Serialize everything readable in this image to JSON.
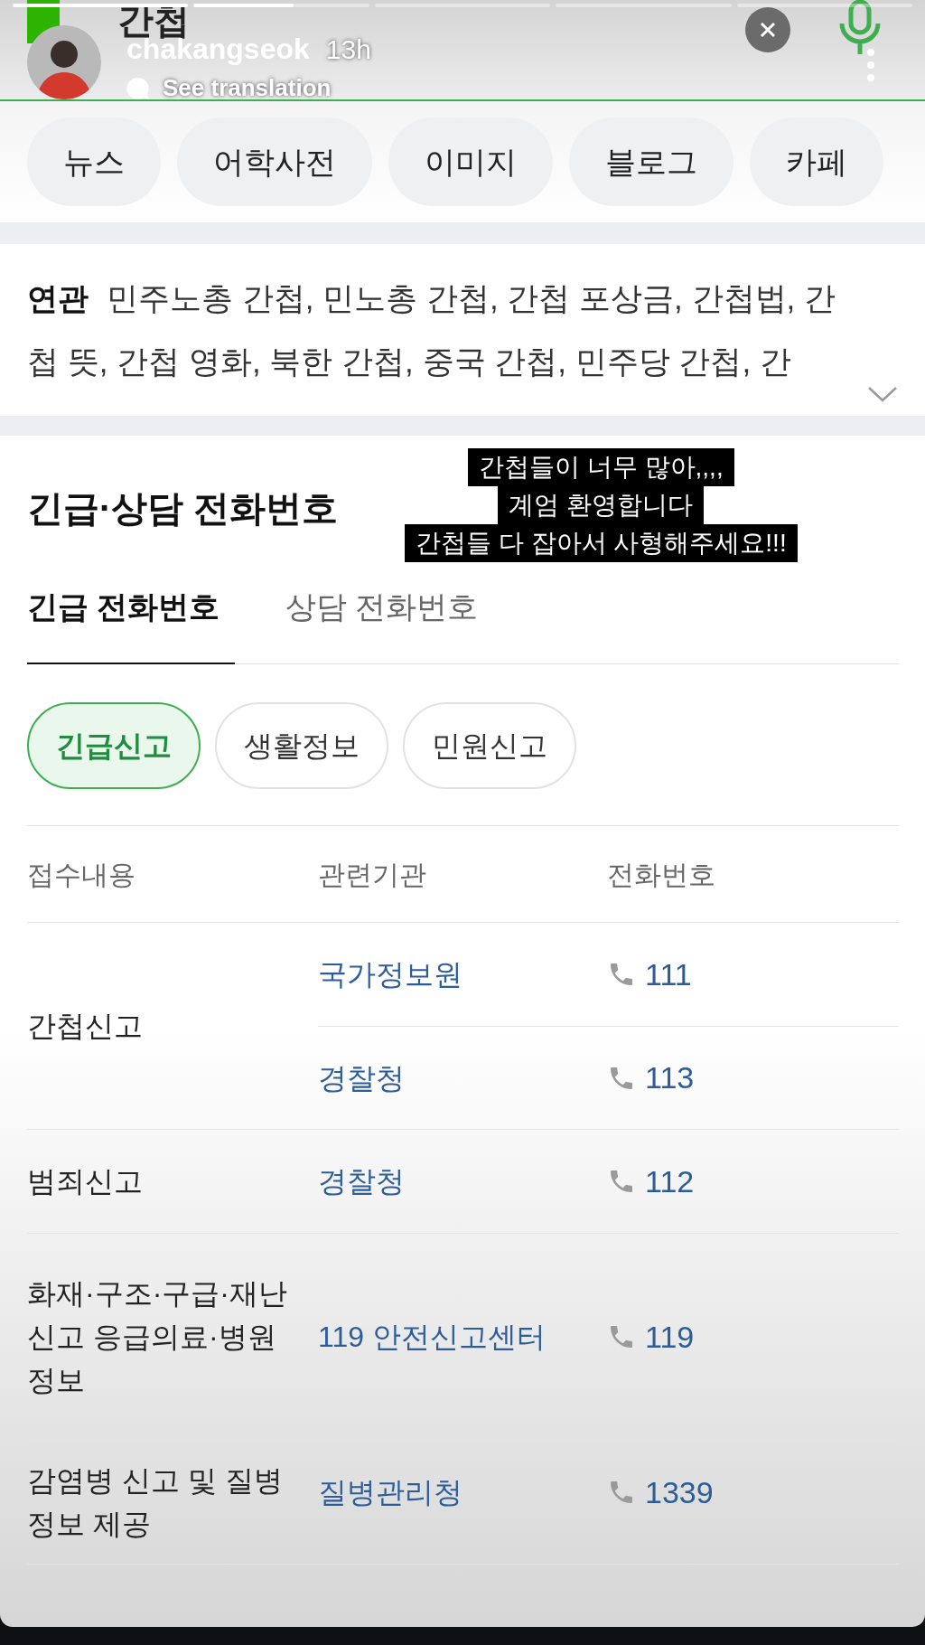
{
  "story": {
    "progress": [
      {
        "level": 1
      },
      {
        "level": 0.57
      },
      {
        "level": 0
      },
      {
        "level": 0
      },
      {
        "level": 0
      }
    ],
    "username": "chakangseok",
    "time": "13h",
    "translation_link": "See translation",
    "caption": [
      "간첩들이 너무 많아,,,,",
      "계엄 환영합니다",
      "간첩들 다 잡아서 사형해주세요!!!"
    ]
  },
  "search": {
    "query": "간첩"
  },
  "chips": [
    "뉴스",
    "어학사전",
    "이미지",
    "블로그",
    "카페"
  ],
  "related": {
    "label": "연관",
    "lines": [
      "민주노총 간첩, 민노총 간첩, 간첩 포상금, 간첩법, 간",
      "첩 뜻, 간첩 영화, 북한 간첩, 중국 간첩, 민주당 간첩, 간"
    ]
  },
  "section": {
    "title": "긴급·상담 전화번호",
    "tabs": [
      {
        "label": "긴급 전화번호",
        "selected": true
      },
      {
        "label": "상담 전화번호",
        "selected": false
      }
    ],
    "filters": [
      {
        "label": "긴급신고",
        "selected": true
      },
      {
        "label": "생활정보",
        "selected": false
      },
      {
        "label": "민원신고",
        "selected": false
      }
    ],
    "columns": [
      "접수내용",
      "관련기관",
      "전화번호"
    ],
    "rows": [
      {
        "category": "간첩신고",
        "entries": [
          {
            "agency": "국가정보원",
            "phone": "111"
          },
          {
            "agency": "경찰청",
            "phone": "113"
          }
        ]
      },
      {
        "category": "범죄신고",
        "entries": [
          {
            "agency": "경찰청",
            "phone": "112"
          }
        ]
      },
      {
        "category": "화재·구조·구급·재난신고 응급의료·병원 정보",
        "entries": [
          {
            "agency": "119 안전신고센터",
            "phone": "119"
          }
        ]
      },
      {
        "category": "감염병 신고 및 질병 정보 제공",
        "entries": [
          {
            "agency": "질병관리청",
            "phone": "1339"
          }
        ]
      }
    ]
  }
}
